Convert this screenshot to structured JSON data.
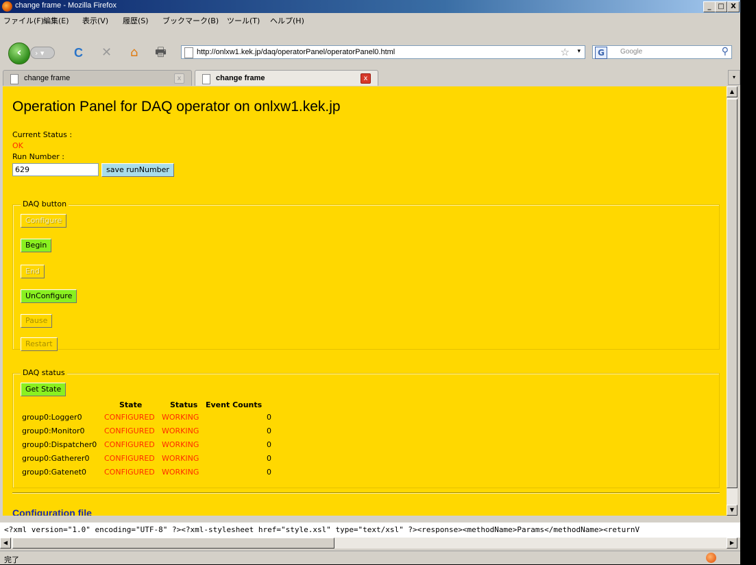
{
  "window": {
    "title": "change frame - Mozilla Firefox",
    "minimize": "_",
    "maximize": "□",
    "close": "X"
  },
  "menu": [
    "ファイル(F)",
    "編集(E)",
    "表示(V)",
    "履歴(S)",
    "ブックマーク(B)",
    "ツール(T)",
    "ヘルプ(H)"
  ],
  "nav": {
    "url": "http://onlxw1.kek.jp/daq/operatorPanel/operatorPanel0.html",
    "search_placeholder": "Google",
    "back_glyph": "‹",
    "forward_glyph": "› ▾",
    "reload_glyph": "C",
    "stop_glyph": "✕",
    "home_glyph": "⌂",
    "print_glyph": "🖶",
    "star_glyph": "☆",
    "dropdown_glyph": "▾",
    "search_engine_glyph": "G",
    "search_glyph": "⚲"
  },
  "tabs": [
    {
      "label": "change frame",
      "close_glyph": "x"
    },
    {
      "label": "change frame",
      "close_glyph": "x"
    }
  ],
  "tablist_glyph": "▾",
  "page": {
    "title": "Operation Panel for DAQ operator on onlxw1.kek.jp",
    "current_status_label": "Current Status :",
    "current_status_value": "OK",
    "run_number_label": "Run Number :",
    "run_number_value": "629",
    "save_button": "save runNumber",
    "daq_button_legend": "DAQ button",
    "buttons": {
      "configure": "Configure",
      "begin": "Begin",
      "end": "End",
      "unconfigure": "UnConfigure",
      "pause": "Pause",
      "restart": "Restart"
    },
    "daq_status_legend": "DAQ status",
    "get_state_button": "Get State",
    "table_headers": {
      "state": "State",
      "status": "Status",
      "event_counts": "Event Counts"
    },
    "rows": [
      {
        "name": "group0:Logger0",
        "state": "CONFIGURED",
        "status": "WORKING",
        "count": "0"
      },
      {
        "name": "group0:Monitor0",
        "state": "CONFIGURED",
        "status": "WORKING",
        "count": "0"
      },
      {
        "name": "group0:Dispatcher0",
        "state": "CONFIGURED",
        "status": "WORKING",
        "count": "0"
      },
      {
        "name": "group0:Gatherer0",
        "state": "CONFIGURED",
        "status": "WORKING",
        "count": "0"
      },
      {
        "name": "group0:Gatenet0",
        "state": "CONFIGURED",
        "status": "WORKING",
        "count": "0"
      }
    ],
    "config_heading": "Configuration file"
  },
  "xml_response": "<?xml version=\"1.0\" encoding=\"UTF-8\" ?><?xml-stylesheet href=\"style.xsl\" type=\"text/xsl\" ?><response><methodName>Params</methodName><returnV",
  "scroll_glyphs": {
    "up": "▲",
    "down": "▼",
    "left": "◀",
    "right": "▶"
  },
  "status_bar": "完了",
  "colors": {
    "page_bg": "#ffd800",
    "status_red": "#ff2a00",
    "button_green": "#8af020",
    "button_blue": "#a9dcea",
    "config_heading": "#1a2ab0"
  }
}
